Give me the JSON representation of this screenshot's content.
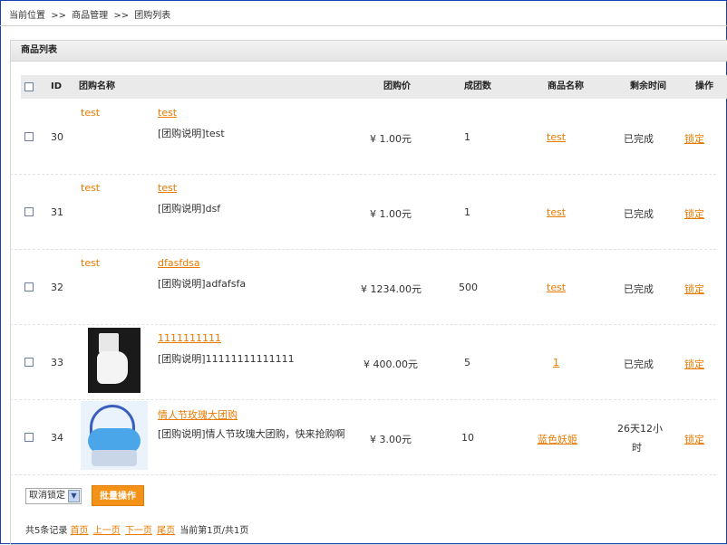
{
  "breadcrumb": {
    "prefix": "当前位置",
    "sep": ">>",
    "level1": "商品管理",
    "level2": "团购列表"
  },
  "panel": {
    "title": "商品列表"
  },
  "columns": {
    "id": "ID",
    "name": "团购名称",
    "price": "团购价",
    "count": "成团数",
    "product": "商品名称",
    "remaining": "剩余时间",
    "action": "操作"
  },
  "rows": [
    {
      "id": "30",
      "thumb_text": "test",
      "title": "test",
      "desc": "[团购说明]test",
      "price": "¥ 1.00元",
      "count": "1",
      "product": "test",
      "remaining": "已完成",
      "action": "锁定"
    },
    {
      "id": "31",
      "thumb_text": "test",
      "title": "test",
      "desc": "[团购说明]dsf",
      "price": "¥ 1.00元",
      "count": "1",
      "product": "test",
      "remaining": "已完成",
      "action": "锁定"
    },
    {
      "id": "32",
      "thumb_text": "test",
      "title": "dfasfdsa",
      "desc": "[团购说明]adfafsfa",
      "price": "¥ 1234.00元",
      "count": "500",
      "product": "test",
      "remaining": "已完成",
      "action": "锁定"
    },
    {
      "id": "33",
      "thumb_text": "",
      "title": "1111111111",
      "desc": "[团购说明]11111111111111",
      "price": "¥ 400.00元",
      "count": "5",
      "product": "1",
      "remaining": "已完成",
      "action": "锁定"
    },
    {
      "id": "34",
      "thumb_text": "",
      "title": "情人节玫瑰大团购",
      "desc": "[团购说明]情人节玫瑰大团购，快来抢购啊",
      "price": "¥ 3.00元",
      "count": "10",
      "product": "蓝色妖姬",
      "remaining_line1": "26天12小",
      "remaining_line2": "时",
      "action": "锁定"
    }
  ],
  "bulk": {
    "select_value": "取消锁定",
    "button": "批量操作"
  },
  "pager": {
    "total": "共5条记录",
    "first": "首页",
    "prev": "上一页",
    "next": "下一页",
    "last": "尾页",
    "current": "当前第1页/共1页"
  }
}
